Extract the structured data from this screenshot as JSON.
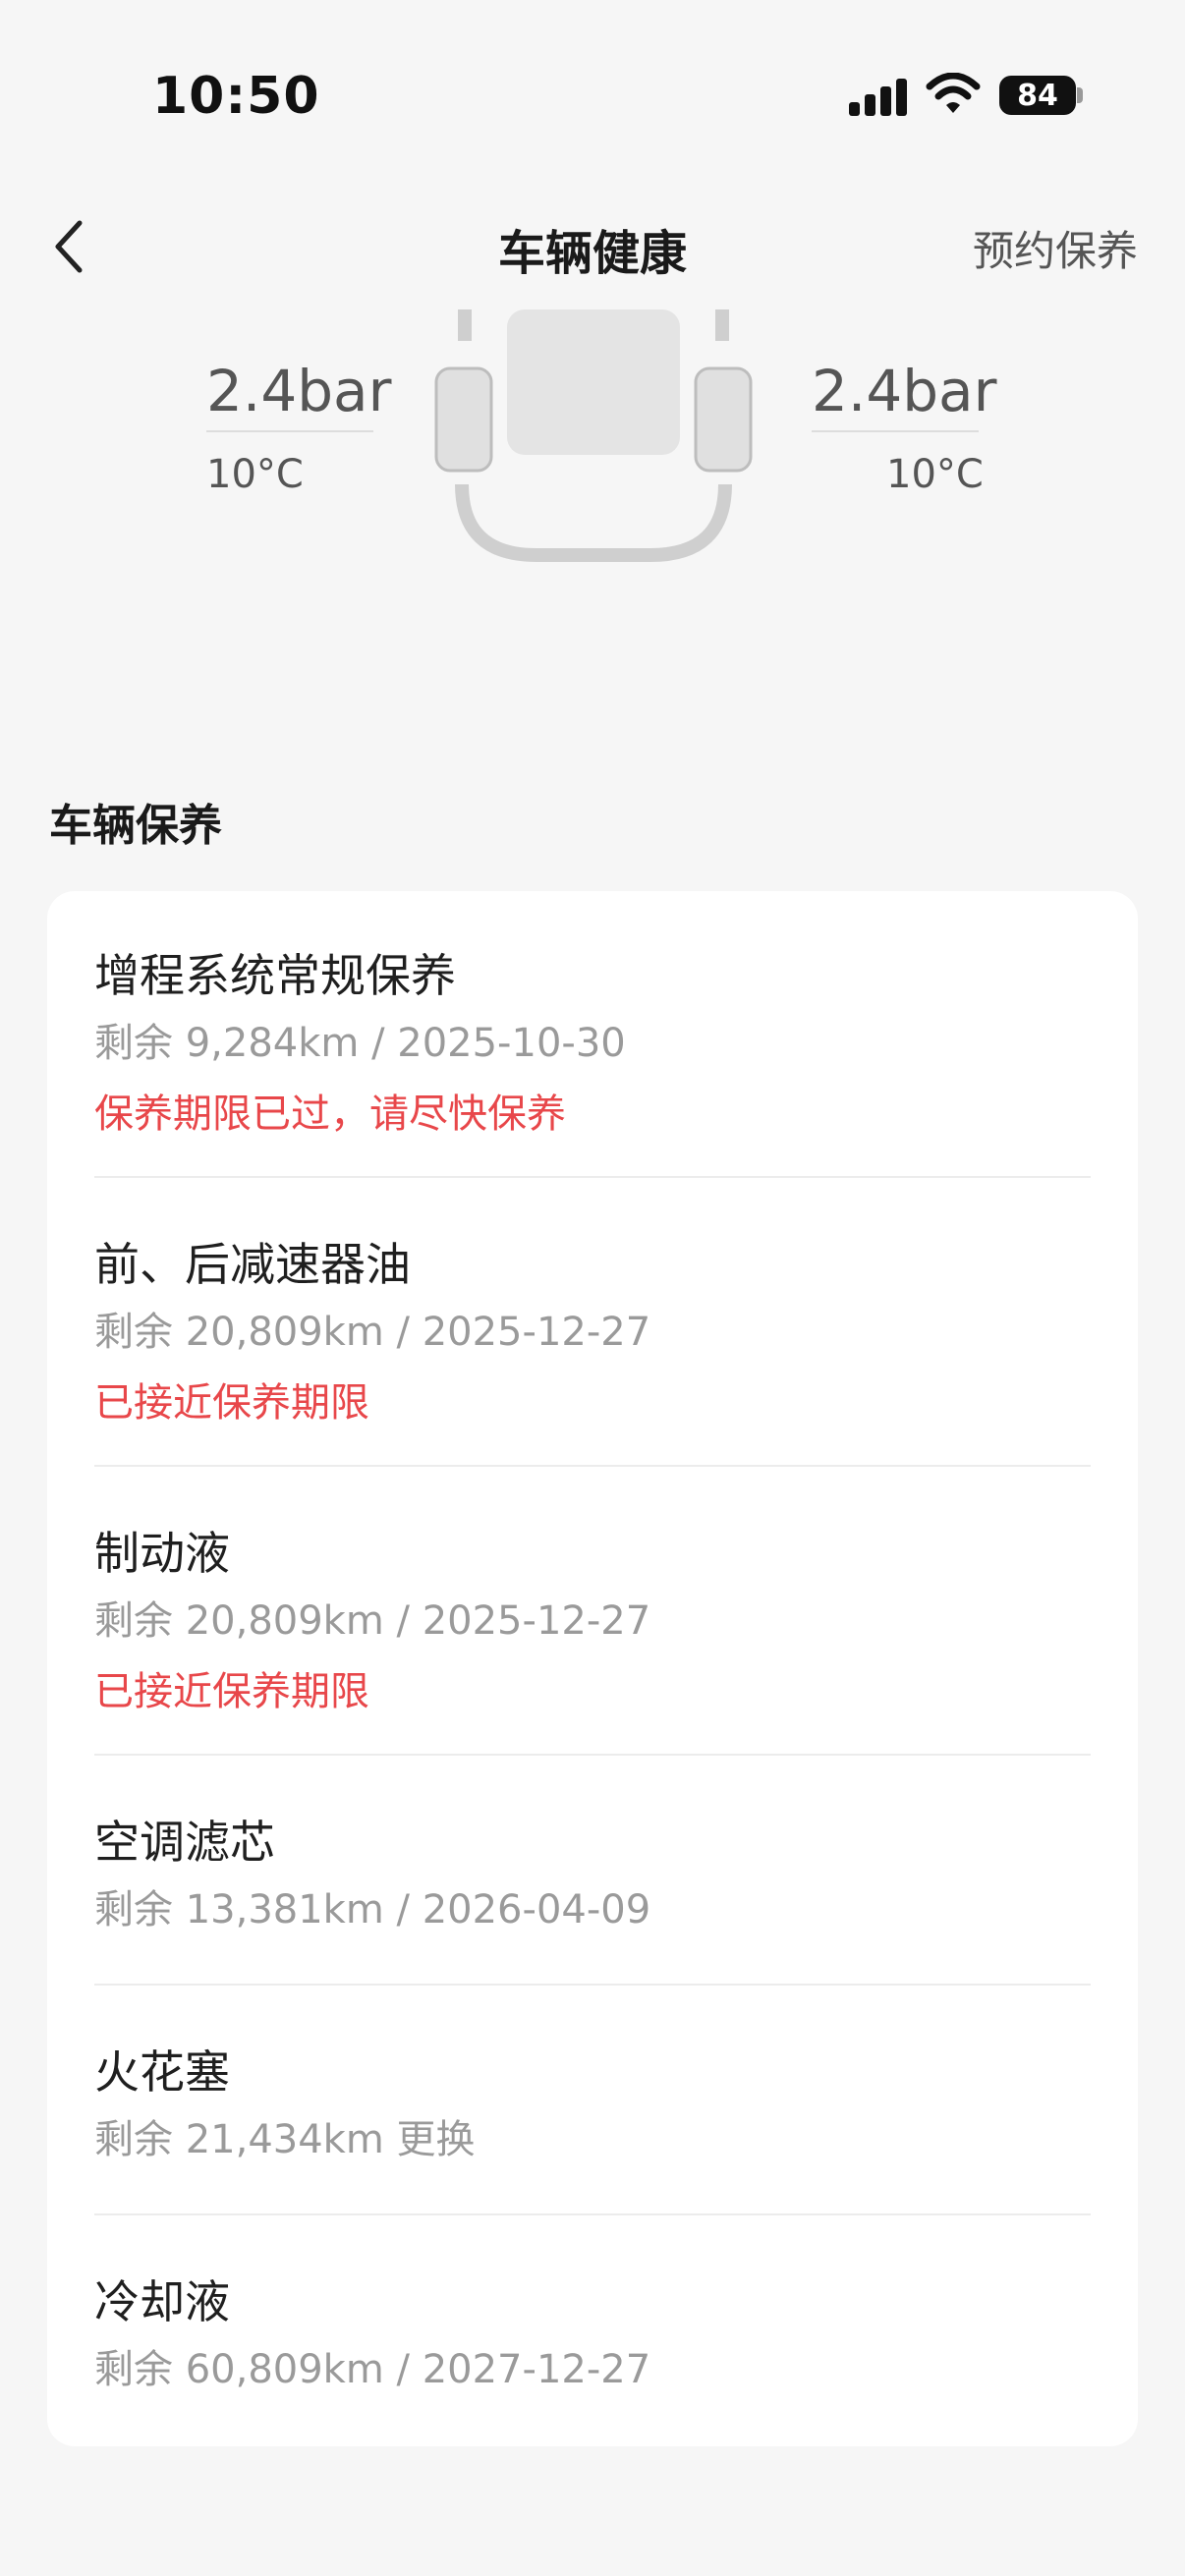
{
  "status_bar": {
    "time": "10:50",
    "battery": "84"
  },
  "nav": {
    "title": "车辆健康",
    "action": "预约保养"
  },
  "tires": {
    "left": {
      "pressure": "2.4bar",
      "temp": "10°C"
    },
    "right": {
      "pressure": "2.4bar",
      "temp": "10°C"
    }
  },
  "maintenance": {
    "title": "车辆保养",
    "items": [
      {
        "name": "增程系统常规保养",
        "detail": "剩余 9,284km / 2025-10-30",
        "warning": "保养期限已过，请尽快保养"
      },
      {
        "name": "前、后减速器油",
        "detail": "剩余 20,809km / 2025-12-27",
        "warning": "已接近保养期限"
      },
      {
        "name": "制动液",
        "detail": "剩余 20,809km / 2025-12-27",
        "warning": "已接近保养期限"
      },
      {
        "name": "空调滤芯",
        "detail": "剩余 13,381km / 2026-04-09"
      },
      {
        "name": "火花塞",
        "detail": "剩余 21,434km 更换"
      },
      {
        "name": "冷却液",
        "detail": "剩余 60,809km / 2027-12-27"
      }
    ]
  },
  "colors": {
    "warning": "#e8474a",
    "background": "#f6f6f6",
    "card": "#ffffff"
  },
  "icons": {
    "back": "chevron-left-icon",
    "signal": "cellular-signal-icon",
    "wifi": "wifi-icon",
    "battery": "battery-icon"
  }
}
